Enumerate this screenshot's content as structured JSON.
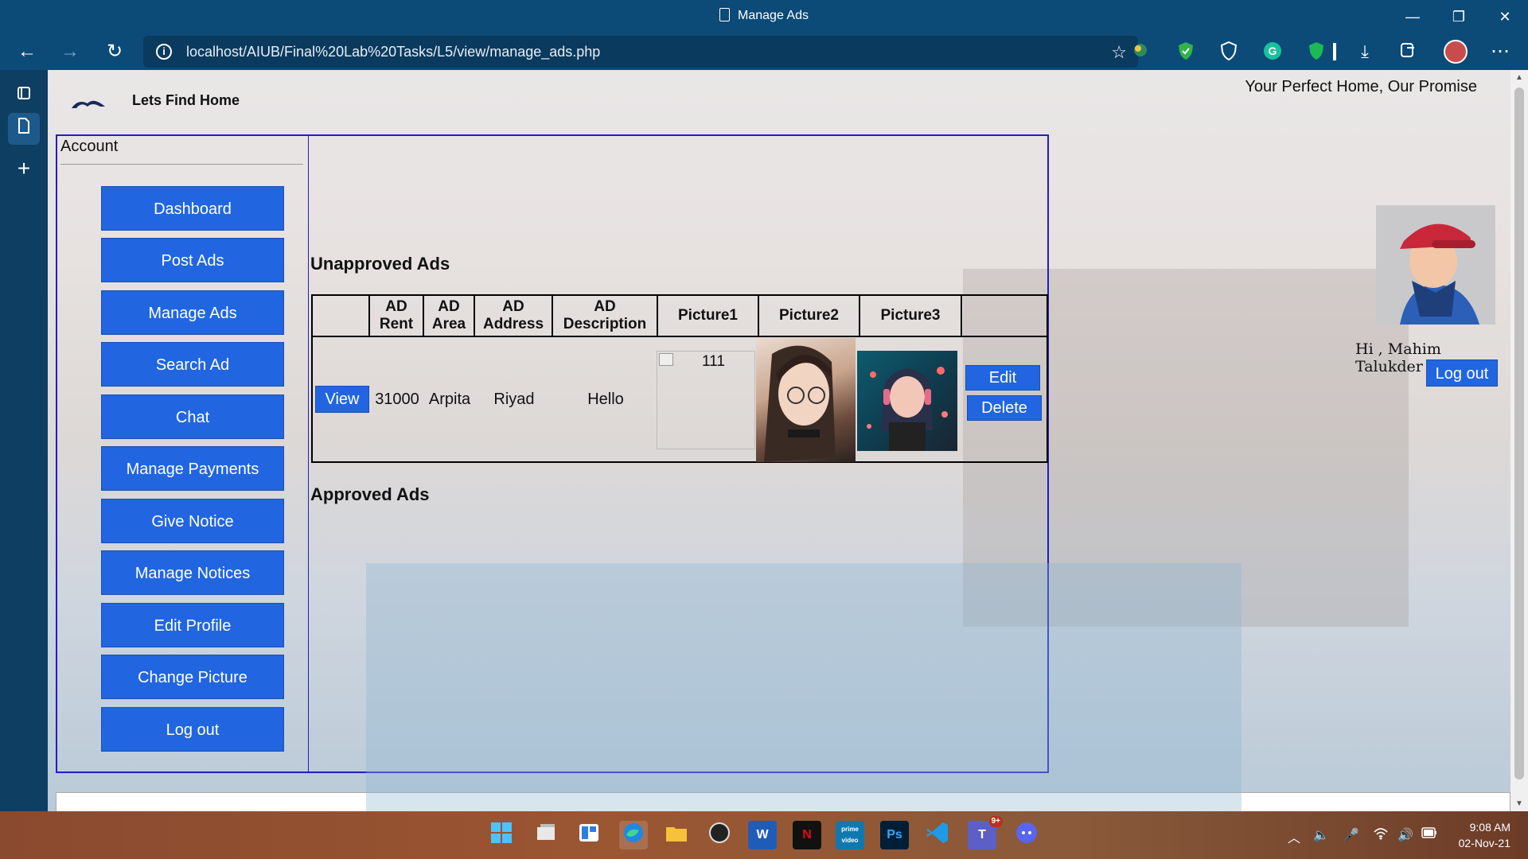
{
  "window": {
    "title": "Manage Ads",
    "minimize": "—",
    "maximize": "❐",
    "close": "✕"
  },
  "browser": {
    "back": "←",
    "forward": "→",
    "reload": "↻",
    "url": "localhost/AIUB/Final%20Lab%20Tasks/L5/view/manage_ads.php",
    "info_glyph": "i",
    "favorite": "☆",
    "download": "⤓",
    "more": "⋯",
    "extensions": [
      "ext-1-icon",
      "shield-check-icon",
      "shield-icon",
      "grammarly-icon",
      "vpn-icon"
    ]
  },
  "vertical_tabs": [
    "tab-panel-icon",
    "page-icon",
    "plus-icon"
  ],
  "site": {
    "name": "Lets Find Home",
    "tagline": "Your Perfect Home, Our Promise"
  },
  "sidebar": {
    "section": "Account",
    "buttons": [
      "Dashboard",
      "Post Ads",
      "Manage Ads",
      "Search Ad",
      "Chat",
      "Manage Payments",
      "Give Notice",
      "Manage Notices",
      "Edit Profile",
      "Change Picture",
      "Log out"
    ]
  },
  "main": {
    "unapproved_heading": "Unapproved Ads",
    "approved_heading": "Approved Ads",
    "columns": [
      "",
      "AD Rent",
      "AD Area",
      "AD Address",
      "AD Description",
      "Picture1",
      "Picture2",
      "Picture3",
      ""
    ],
    "rows": [
      {
        "view_label": "View",
        "rent": "31000",
        "area": "Arpita",
        "address": "Riyad",
        "description": "Hello",
        "picture1_alt": "111",
        "edit_label": "Edit",
        "delete_label": "Delete"
      }
    ]
  },
  "profile": {
    "greeting": "Hi , Mahim Talukder",
    "logout": "Log out"
  },
  "taskbar": {
    "apps": [
      "windows-start-icon",
      "task-view-icon",
      "widgets-icon",
      "edge-icon",
      "file-explorer-icon",
      "obs-icon",
      "word-icon",
      "netflix-icon",
      "prime-video-icon",
      "photoshop-icon",
      "vscode-icon",
      "teams-icon",
      "discord-icon"
    ],
    "app_glyphs": {
      "word": "W",
      "netflix": "N",
      "photoshop": "Ps",
      "teams": "T",
      "prime": "prime video"
    },
    "teams_badge": "9+",
    "time": "9:08 AM",
    "date": "02-Nov-21"
  },
  "colors": {
    "button_blue": "#2166e0",
    "frame_border": "#1f1fbf",
    "browser_chrome": "#0c4a78"
  }
}
